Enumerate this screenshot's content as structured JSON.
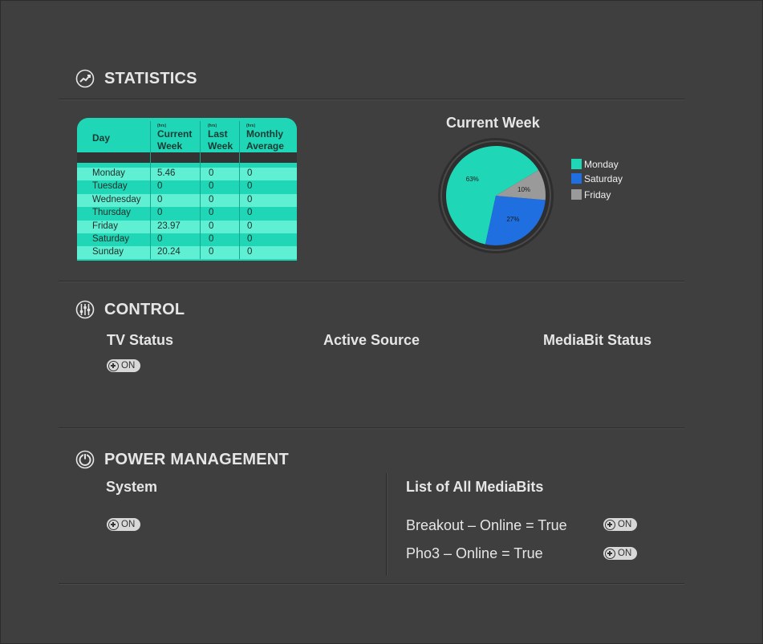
{
  "statistics": {
    "title": "STATISTICS",
    "table": {
      "headers": [
        {
          "unit": "",
          "label": "Day"
        },
        {
          "unit": "(hrs)",
          "label": "Current Week"
        },
        {
          "unit": "(hrs)",
          "label": "Last Week"
        },
        {
          "unit": "(hrs)",
          "label": "Monthly Average"
        }
      ],
      "rows": [
        {
          "day": "Monday",
          "current": "5.46",
          "last": "0",
          "avg": "0"
        },
        {
          "day": "Tuesday",
          "current": "0",
          "last": "0",
          "avg": "0"
        },
        {
          "day": "Wednesday",
          "current": "0",
          "last": "0",
          "avg": "0"
        },
        {
          "day": "Thursday",
          "current": "0",
          "last": "0",
          "avg": "0"
        },
        {
          "day": "Friday",
          "current": "23.97",
          "last": "0",
          "avg": "0"
        },
        {
          "day": "Saturday",
          "current": "0",
          "last": "0",
          "avg": "0"
        },
        {
          "day": "Sunday",
          "current": "20.24",
          "last": "0",
          "avg": "0"
        }
      ]
    },
    "chart_data": {
      "type": "pie",
      "title": "Current Week",
      "categories": [
        "Monday",
        "Saturday",
        "Friday"
      ],
      "values": [
        63,
        27,
        10
      ],
      "labels": [
        "63%",
        "27%",
        "10%"
      ],
      "colors": [
        "#1fd6b6",
        "#1f6fe0",
        "#9a9a9a"
      ],
      "legend": "right"
    }
  },
  "control": {
    "title": "CONTROL",
    "tv_status_label": "TV Status",
    "tv_toggle": "ON",
    "active_source_label": "Active Source",
    "mediabit_status_label": "MediaBit Status"
  },
  "power": {
    "title": "POWER MANAGEMENT",
    "system_label": "System",
    "system_toggle": "ON",
    "list_title": "List of All MediaBits",
    "mediabits": [
      {
        "text": "Breakout – Online = True",
        "toggle": "ON"
      },
      {
        "text": "Pho3 – Online = True",
        "toggle": "ON"
      }
    ]
  },
  "colors": {
    "background": "#3f3f3f",
    "accent": "#1fd6b6",
    "accent_light": "#5ff0d3",
    "blue": "#1f6fe0",
    "gray": "#9a9a9a"
  }
}
